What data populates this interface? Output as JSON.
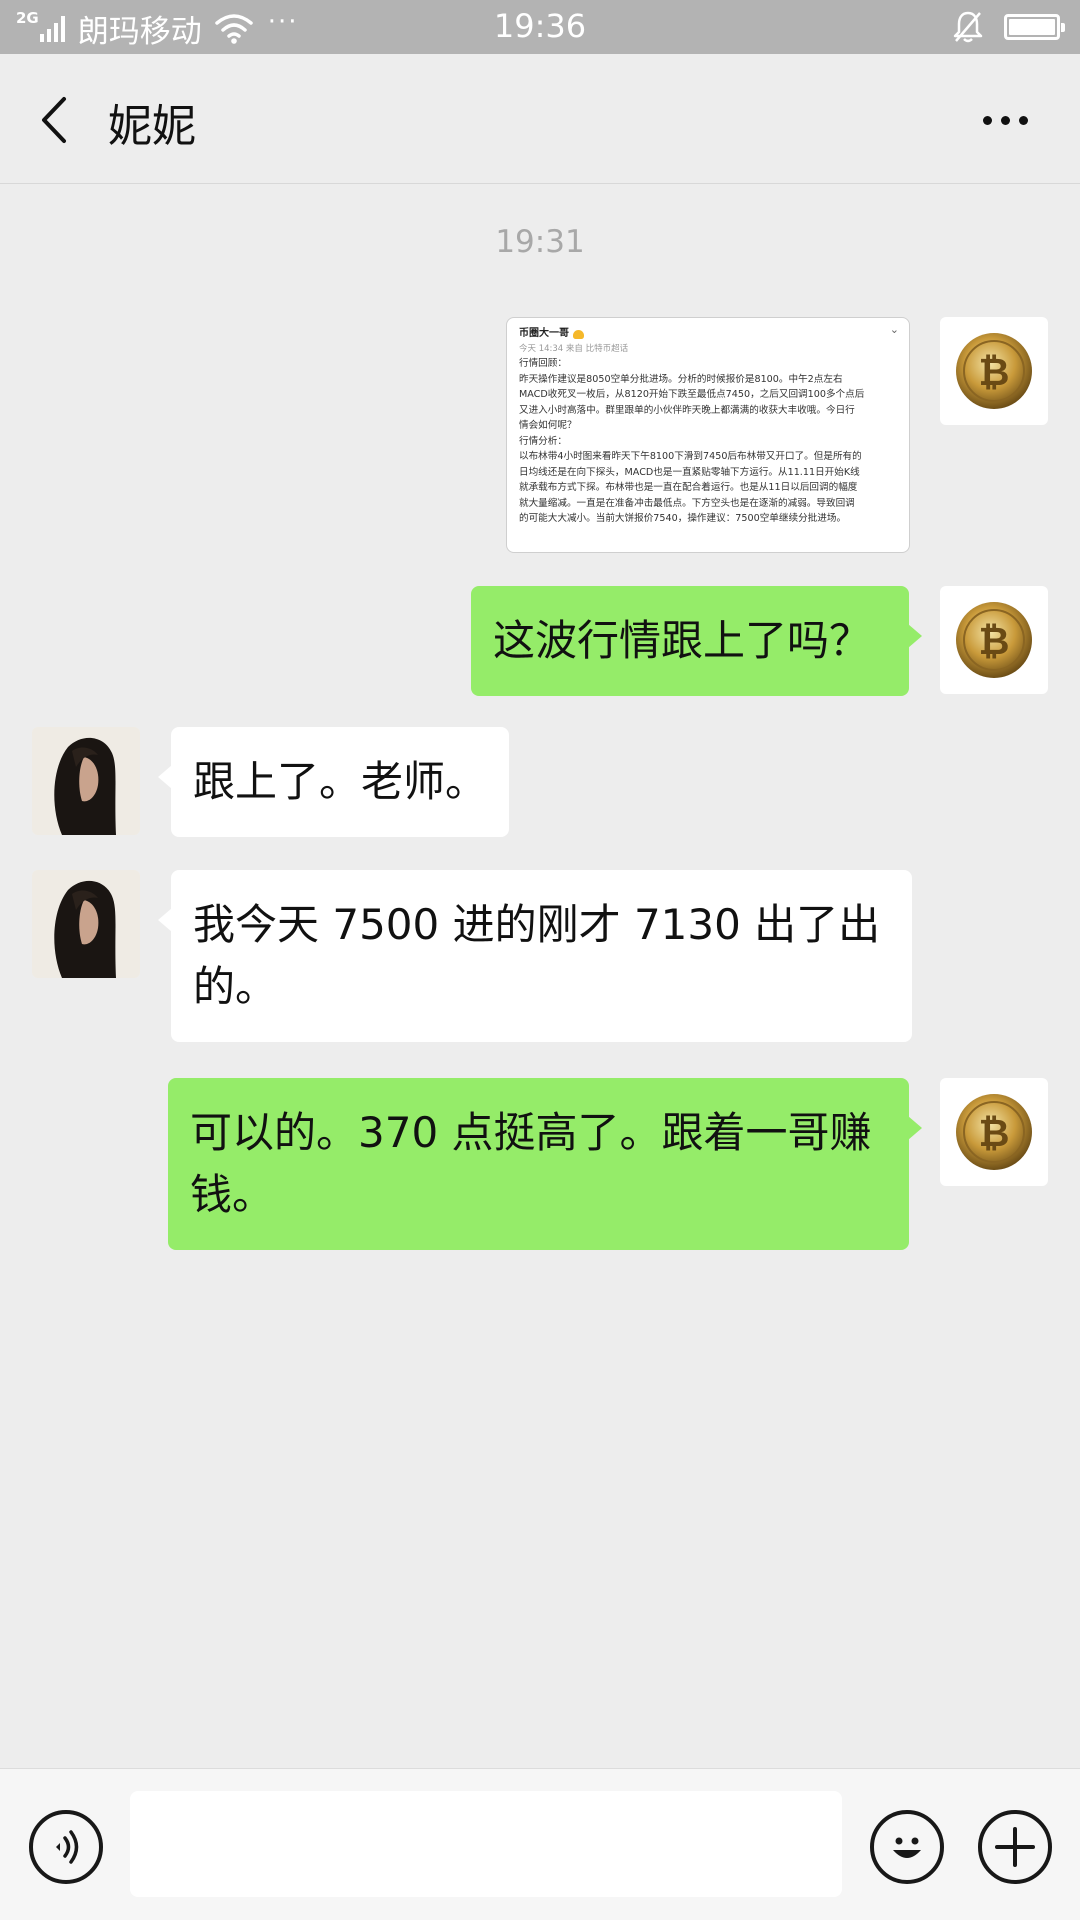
{
  "status_bar": {
    "network": "2G",
    "carrier": "朗玛移动",
    "dots": "···",
    "time": "19:36"
  },
  "header": {
    "title": "妮妮"
  },
  "chat": {
    "timestamp": "19:31",
    "image_post": {
      "author": "币圈大一哥",
      "meta": "今天 14:34 来自 比特币超话",
      "lines": [
        "行情回顾：",
        "昨天操作建议是8050空单分批进场。分析的时候报价是8100。中午2点左右",
        "MACD收死叉一枚后，从8120开始下跌至最低点7450，之后又回调100多个点后",
        "又进入小时高落中。群里跟单的小伙伴昨天晚上都满满的收获大丰收哦。今日行",
        "情会如何呢？",
        "行情分析：",
        "以布林带4小时图来看昨天下午8100下滑到7450后布林带又开口了。但是所有的",
        "日均线还是在向下探头，MACD也是一直紧贴零轴下方运行。从11.11日开始K线",
        "就承载布方式下探。布林带也是一直在配合着运行。也是从11日以后回调的幅度",
        "就大量缩减。一直是在准备冲击最低点。下方空头也是在逐渐的减弱。导致回调",
        "的可能大大减小。当前大饼报价7540，操作建议：7500空单继续分批进场。"
      ]
    },
    "messages": [
      {
        "sender": "me",
        "text": "这波行情跟上了吗？"
      },
      {
        "sender": "other",
        "text": "跟上了。老师。"
      },
      {
        "sender": "other",
        "text": "我今天 7500 进的刚才 7130 出了出的。"
      },
      {
        "sender": "me",
        "text": "可以的。370 点挺高了。跟着一哥赚钱。"
      }
    ]
  },
  "input_bar": {
    "placeholder": ""
  },
  "colors": {
    "my_bubble": "#95ec69",
    "other_bubble": "#ffffff",
    "background": "#ededed",
    "status_bar": "#b3b3b3"
  },
  "icons": [
    "signal-icon",
    "wifi-icon",
    "mute-bell-icon",
    "battery-icon",
    "back-icon",
    "more-icon",
    "voice-icon",
    "emoji-icon",
    "plus-icon"
  ]
}
